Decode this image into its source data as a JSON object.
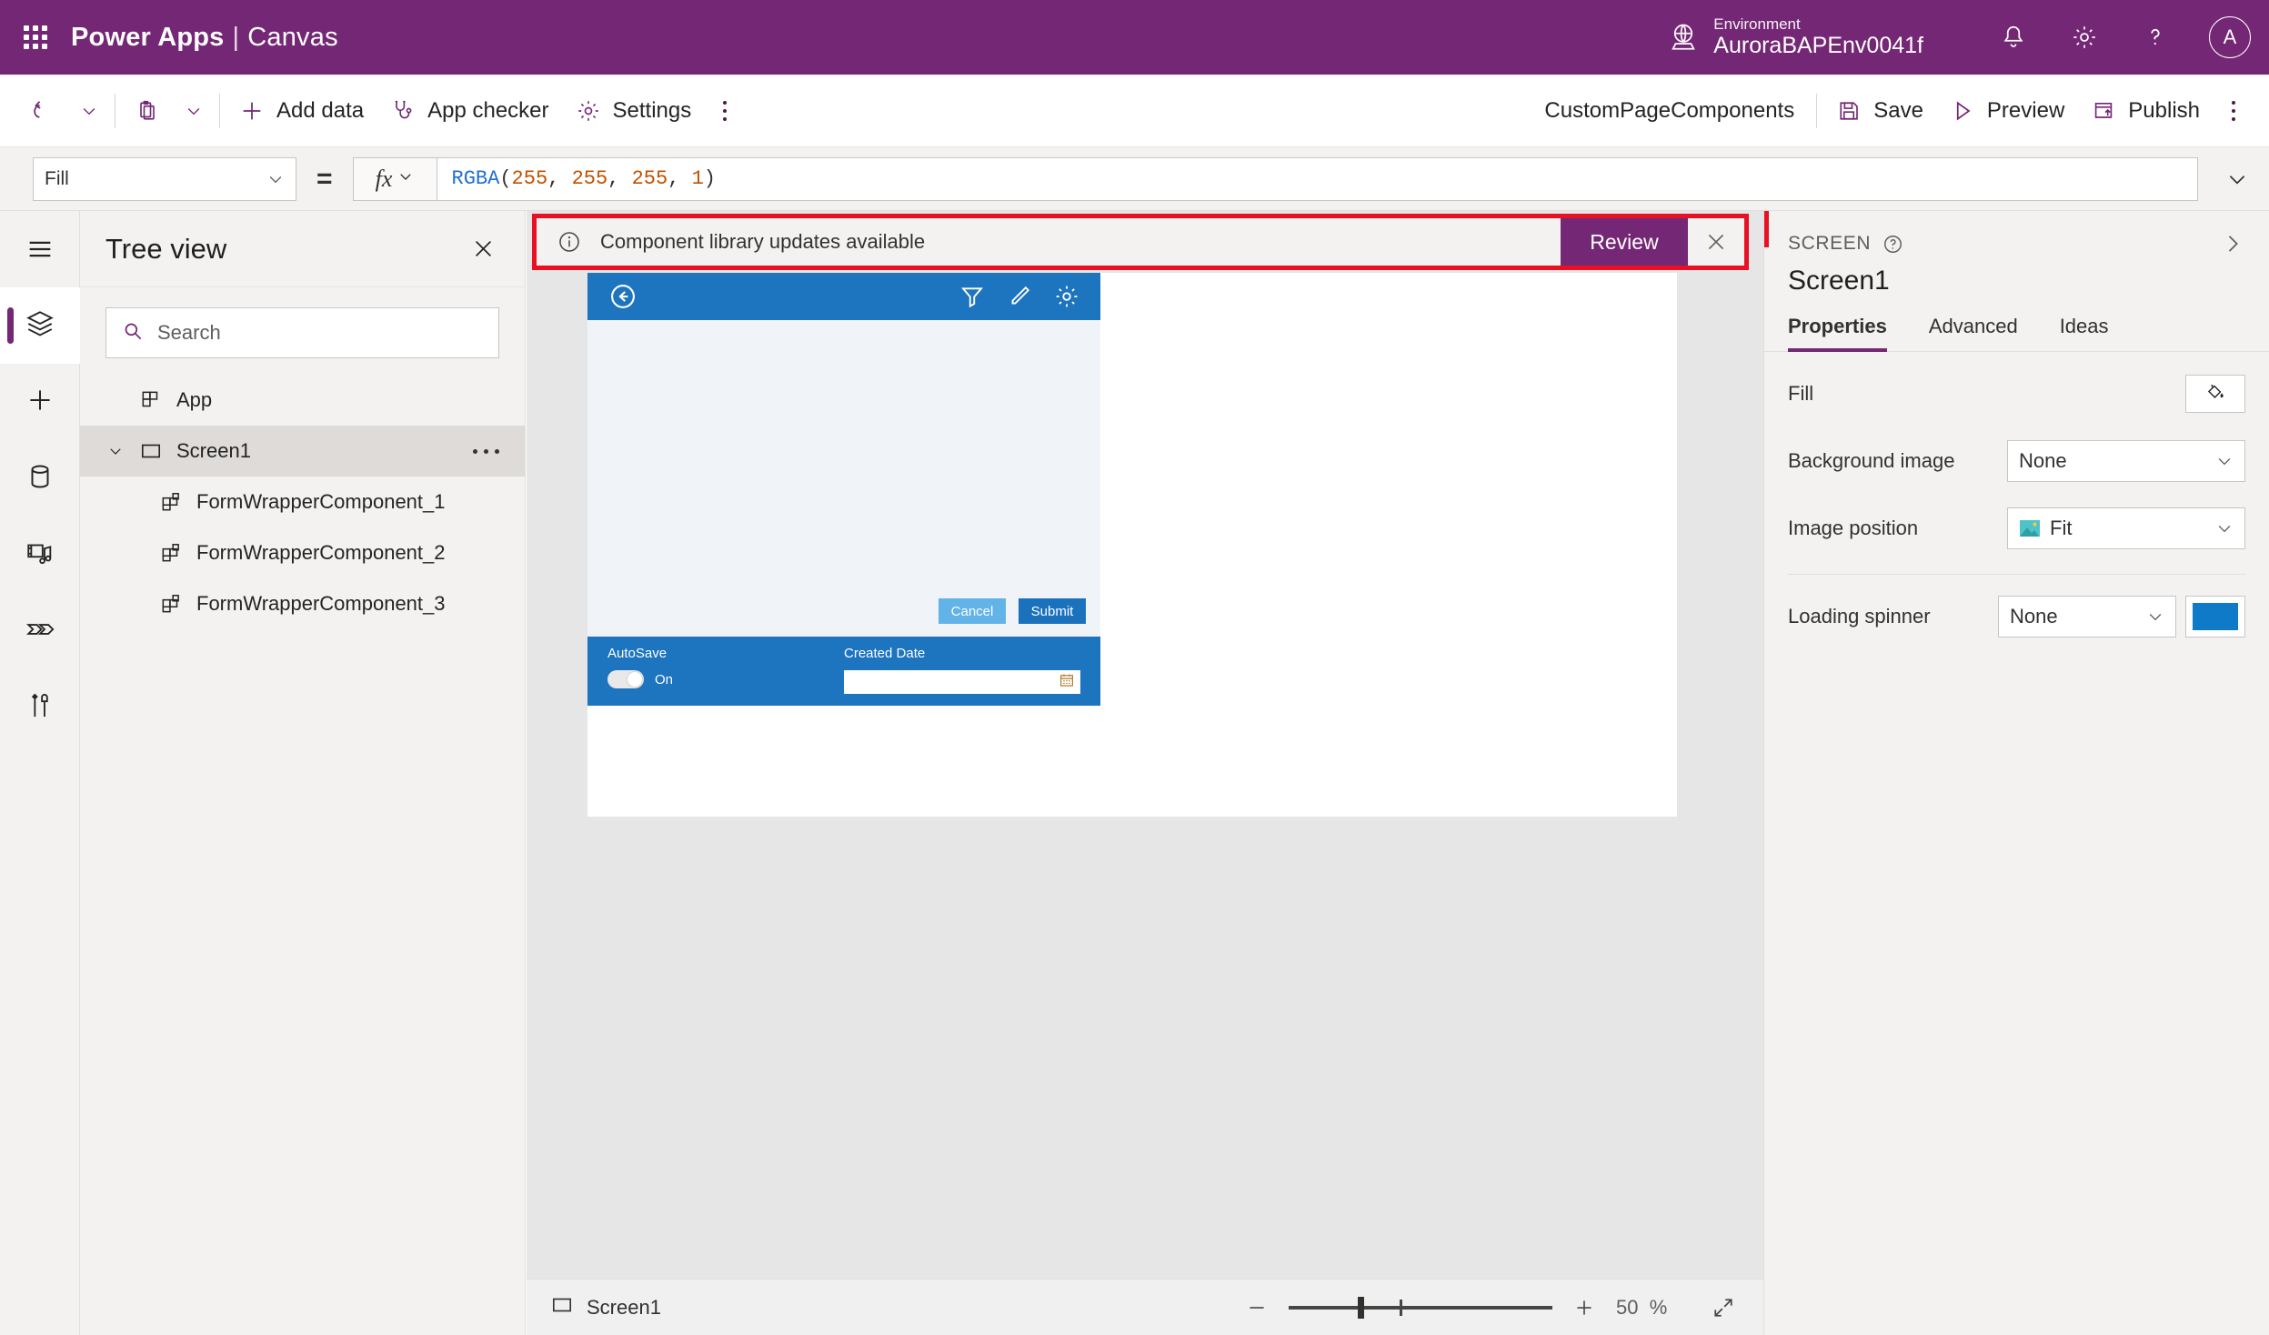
{
  "header": {
    "waffle_icon": "app-launcher-icon",
    "brand": "Power Apps",
    "separator": "|",
    "brand_suffix": "Canvas",
    "environment_label": "Environment",
    "environment_name": "AuroraBAPEnv0041f",
    "globe_icon": "globe-icon",
    "notification_icon": "bell-icon",
    "settings_icon": "gear-icon",
    "help_icon": "question-icon",
    "avatar_initial": "A",
    "brand_color": "#742774"
  },
  "commandbar": {
    "undo_icon": "undo-icon",
    "paste_icon": "paste-icon",
    "add_data": "Add data",
    "app_checker": "App checker",
    "settings": "Settings",
    "overflow_icon": "more-vertical-icon",
    "doc_title": "CustomPageComponents",
    "save": "Save",
    "preview": "Preview",
    "publish": "Publish"
  },
  "formulabar": {
    "property": "Fill",
    "equals": "=",
    "fx_label": "fx",
    "formula_fn": "RGBA",
    "formula_open": "(",
    "formula_args": [
      "255",
      "255",
      "255",
      "1"
    ],
    "formula_close": ")",
    "expand_icon": "chevron-down-icon"
  },
  "rail": {
    "items": [
      {
        "name": "hamburger-menu",
        "icon": "hamburger-icon",
        "selected": false
      },
      {
        "name": "tree-view",
        "icon": "layers-icon",
        "selected": true
      },
      {
        "name": "insert",
        "icon": "plus-icon",
        "selected": false
      },
      {
        "name": "data",
        "icon": "database-icon",
        "selected": false
      },
      {
        "name": "media",
        "icon": "media-icon",
        "selected": false
      },
      {
        "name": "power-automate",
        "icon": "power-automate-icon",
        "selected": false
      },
      {
        "name": "advanced-tools",
        "icon": "tools-icon",
        "selected": false
      }
    ]
  },
  "treeview": {
    "title": "Tree view",
    "close_icon": "close-icon",
    "search_placeholder": "Search",
    "search_value": "",
    "search_icon": "search-icon",
    "items": [
      {
        "label": "App",
        "icon": "app-icon",
        "level": 1,
        "selected": false,
        "expandable": false
      },
      {
        "label": "Screen1",
        "icon": "screen-icon",
        "level": 1,
        "selected": true,
        "expandable": true,
        "more_icon": "more-horizontal-icon"
      },
      {
        "label": "FormWrapperComponent_1",
        "icon": "component-icon",
        "level": 2,
        "selected": false,
        "expandable": false
      },
      {
        "label": "FormWrapperComponent_2",
        "icon": "component-icon",
        "level": 2,
        "selected": false,
        "expandable": false
      },
      {
        "label": "FormWrapperComponent_3",
        "icon": "component-icon",
        "level": 2,
        "selected": false,
        "expandable": false
      }
    ]
  },
  "banner": {
    "info_icon": "info-icon",
    "message": "Component library updates available",
    "review_label": "Review",
    "close_icon": "close-icon",
    "highlight_color": "#e81123",
    "button_color": "#742774"
  },
  "app_preview": {
    "header": {
      "back_icon": "back-arrow-circle-icon",
      "filter_icon": "filter-icon",
      "edit_icon": "pencil-icon",
      "settings_icon": "gear-icon",
      "bar_color": "#1d74bf"
    },
    "body_color": "#f0f4f8",
    "cancel_label": "Cancel",
    "submit_label": "Submit",
    "cancel_color": "#61b3e8",
    "submit_color": "#1a72bd",
    "footer": {
      "autosave_label": "AutoSave",
      "autosave_state": "On",
      "created_date_label": "Created Date",
      "created_date_value": "",
      "calendar_icon": "calendar-icon"
    }
  },
  "properties": {
    "kicker": "SCREEN",
    "help_icon": "question-circle-icon",
    "expand_icon": "chevron-right-icon",
    "name": "Screen1",
    "tabs": [
      {
        "label": "Properties",
        "active": true
      },
      {
        "label": "Advanced",
        "active": false
      },
      {
        "label": "Ideas",
        "active": false
      }
    ],
    "rows": [
      {
        "label": "Fill",
        "control": "color-button",
        "icon": "paint-bucket-icon"
      },
      {
        "label": "Background image",
        "control": "dropdown",
        "value": "None"
      },
      {
        "label": "Image position",
        "control": "dropdown-thumb",
        "value": "Fit",
        "icon": "image-icon"
      },
      {
        "label": "Loading spinner",
        "control": "dropdown-swatch",
        "value": "None",
        "swatch_color": "#0f7ac7"
      }
    ]
  },
  "statusbar": {
    "screen_label": "Screen1",
    "screen_icon": "screen-icon",
    "zoom_out_icon": "minus-icon",
    "zoom_in_icon": "plus-icon",
    "zoom_value": "50",
    "zoom_unit": "%",
    "fit_icon": "fit-screen-icon"
  }
}
